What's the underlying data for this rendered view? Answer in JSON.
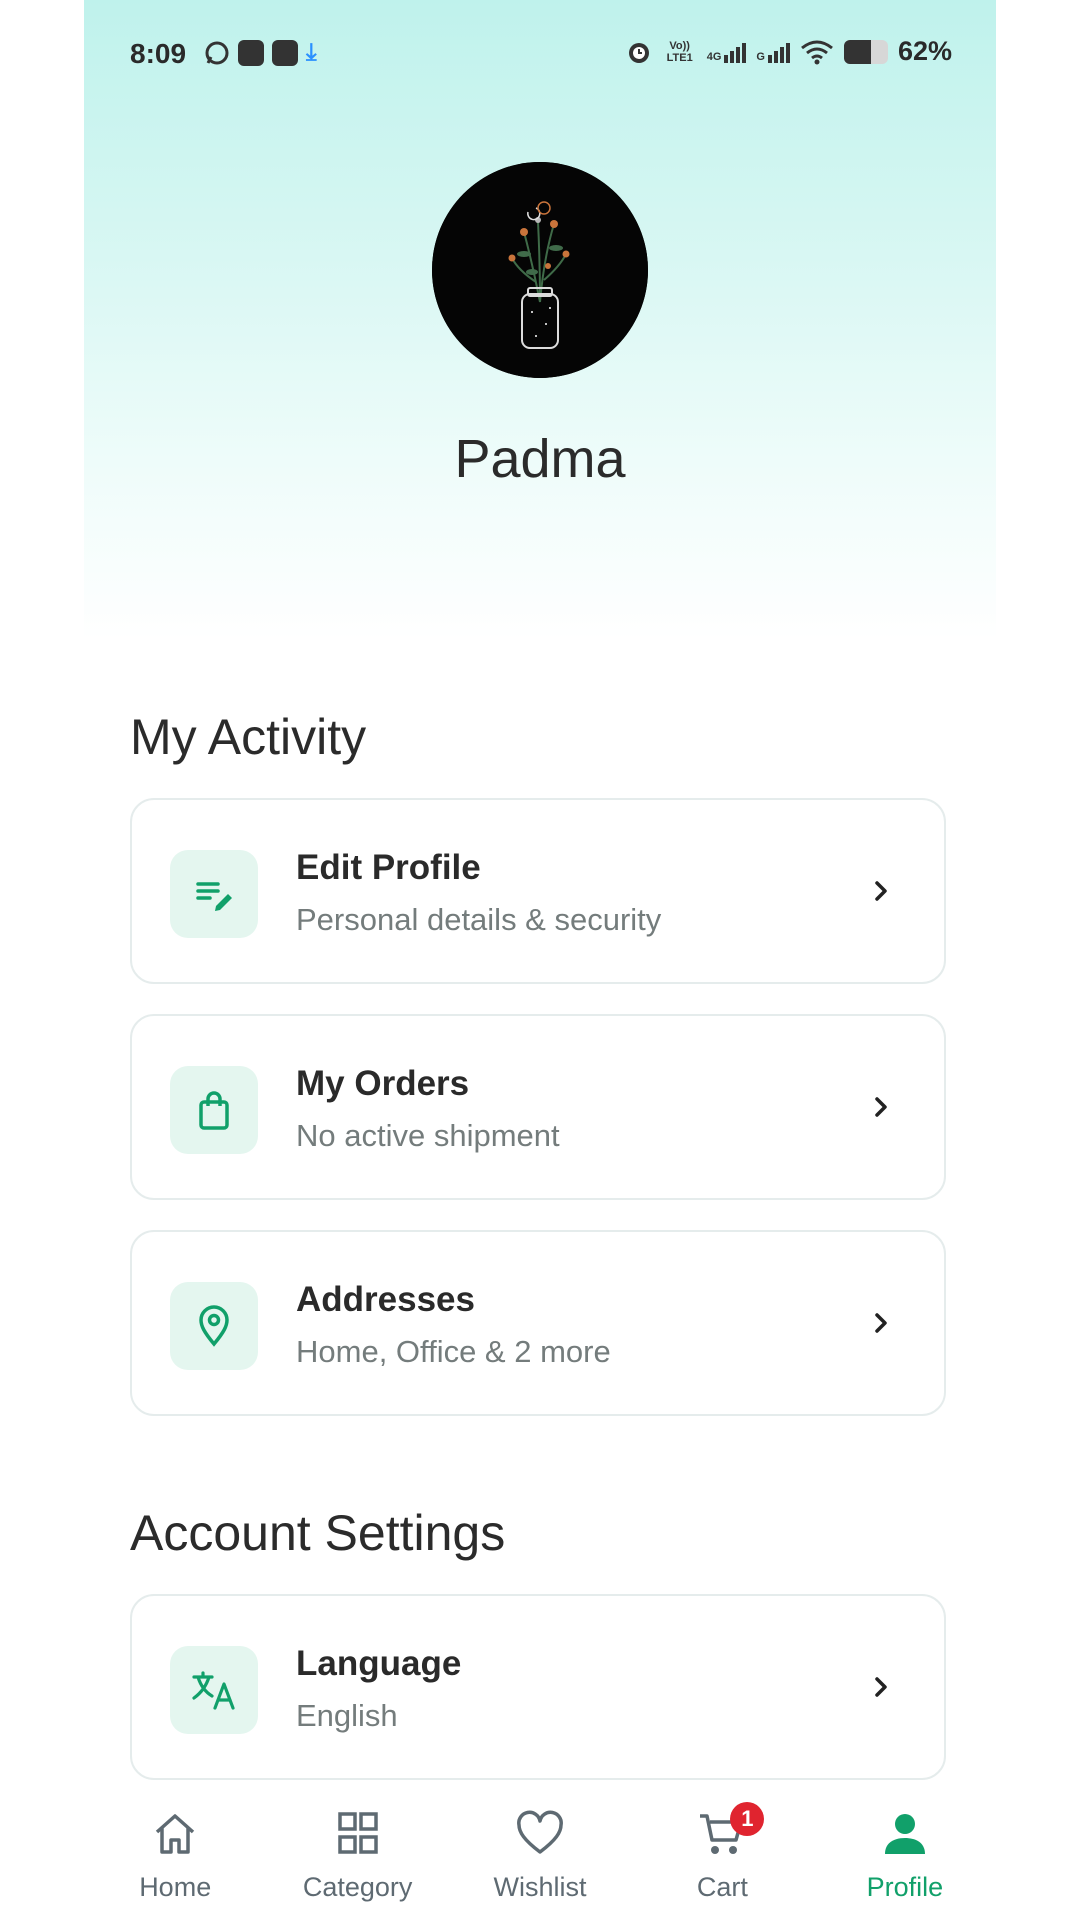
{
  "status_bar": {
    "time": "8:09",
    "volte_label": "Vo)) LTE1",
    "net1_label": "4G",
    "net2_label": "G",
    "battery_percent": "62%",
    "battery_level": 0.62
  },
  "profile": {
    "name": "Padma"
  },
  "sections": {
    "activity_title": "My Activity",
    "settings_title": "Account Settings"
  },
  "activity_items": [
    {
      "title": "Edit Profile",
      "subtitle": "Personal details & security",
      "icon": "edit-list-icon"
    },
    {
      "title": "My Orders",
      "subtitle": "No active shipment",
      "icon": "shopping-bag-icon"
    },
    {
      "title": "Addresses",
      "subtitle": "Home, Office & 2 more",
      "icon": "location-pin-icon"
    }
  ],
  "settings_items": [
    {
      "title": "Language",
      "subtitle": "English",
      "icon": "translate-icon"
    }
  ],
  "bottom_nav": {
    "items": [
      {
        "label": "Home",
        "icon": "home-icon",
        "active": false
      },
      {
        "label": "Category",
        "icon": "grid-icon",
        "active": false
      },
      {
        "label": "Wishlist",
        "icon": "heart-icon",
        "active": false
      },
      {
        "label": "Cart",
        "icon": "cart-icon",
        "active": false,
        "badge": "1"
      },
      {
        "label": "Profile",
        "icon": "person-icon",
        "active": true
      }
    ]
  },
  "colors": {
    "accent": "#11a06a",
    "icon_bg": "#e4f6ef",
    "badge": "#e0242f",
    "hero_top": "#bff2ec"
  }
}
